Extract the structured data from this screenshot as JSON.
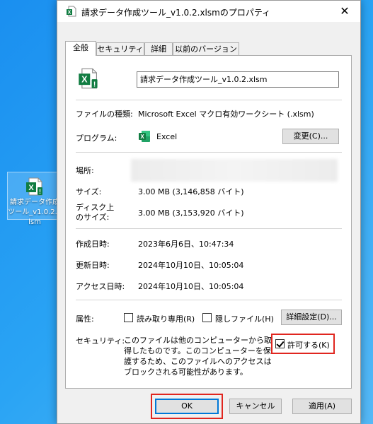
{
  "desktop": {
    "icon_label": "請求データ作成ツール_v1.0.2.xlsm"
  },
  "window": {
    "title": "請求データ作成ツール_v1.0.2.xlsmのプロパティ",
    "close_glyph": "✕"
  },
  "tabs": [
    {
      "label": "全般",
      "active": true
    },
    {
      "label": "セキュリティ",
      "active": false
    },
    {
      "label": "詳細",
      "active": false
    },
    {
      "label": "以前のバージョン",
      "active": false
    }
  ],
  "general": {
    "file_name": "請求データ作成ツール_v1.0.2.xlsm",
    "type_label": "ファイルの種類:",
    "type_value": "Microsoft Excel マクロ有効ワークシート (.xlsm)",
    "program_label": "プログラム:",
    "program_value": "Excel",
    "change_button": "変更(C)...",
    "location_label": "場所:",
    "size_label": "サイズ:",
    "size_value": "3.00 MB (3,146,858 バイト)",
    "disk_size_label_1": "ディスク上",
    "disk_size_label_2": "のサイズ:",
    "disk_size_value": "3.00 MB (3,153,920 バイト)",
    "created_label": "作成日時:",
    "created_value": "2023年6月6日、10:47:34",
    "modified_label": "更新日時:",
    "modified_value": "2024年10月10日、10:05:04",
    "accessed_label": "アクセス日時:",
    "accessed_value": "2024年10月10日、10:05:04",
    "attributes_label": "属性:",
    "readonly_label": "読み取り専用(R)",
    "readonly_checked": false,
    "hidden_label": "隠しファイル(H)",
    "hidden_checked": false,
    "advanced_button": "詳細設定(D)...",
    "security_label": "セキュリティ:",
    "security_text": "このファイルは他のコンピューターから取得したものです。このコンピューターを保護するため、このファイルへのアクセスはブロックされる可能性があります。",
    "unblock_label": "許可する(K)",
    "unblock_checked": true
  },
  "buttons": {
    "ok": "OK",
    "cancel": "キャンセル",
    "apply": "適用(A)"
  },
  "colors": {
    "excel_green": "#107c41",
    "highlight_red": "#e0261f",
    "focus_blue": "#0078d7"
  }
}
